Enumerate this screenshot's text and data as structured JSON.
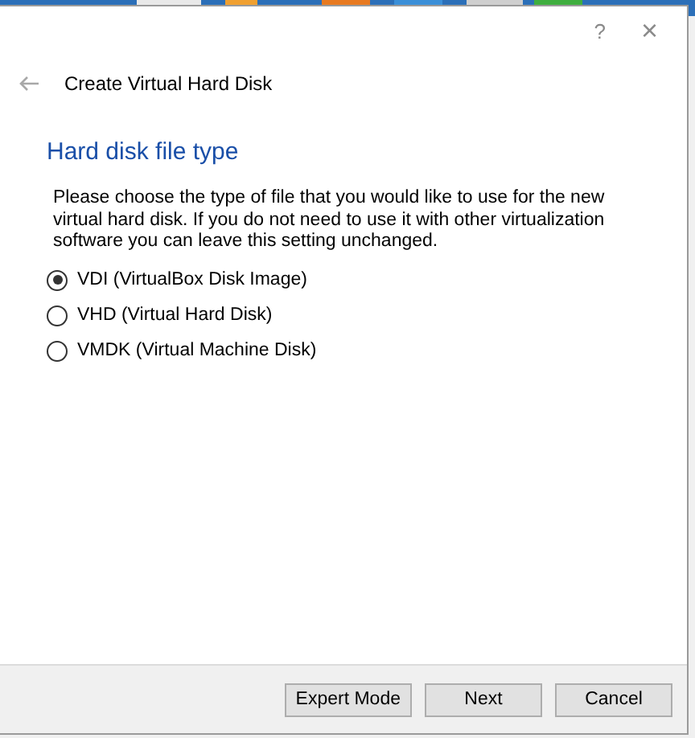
{
  "window": {
    "title": "Create Virtual Hard Disk",
    "help": "?",
    "close": "×"
  },
  "page": {
    "heading": "Hard disk file type",
    "description": "Please choose the type of file that you would like to use for the new virtual hard disk. If you do not need to use it with other virtualization software you can leave this setting unchanged."
  },
  "options": [
    {
      "label": "VDI (VirtualBox Disk Image)",
      "selected": true
    },
    {
      "label": "VHD (Virtual Hard Disk)",
      "selected": false
    },
    {
      "label": "VMDK (Virtual Machine Disk)",
      "selected": false
    }
  ],
  "buttons": [
    "Expert Mode",
    "Next",
    "Cancel"
  ]
}
